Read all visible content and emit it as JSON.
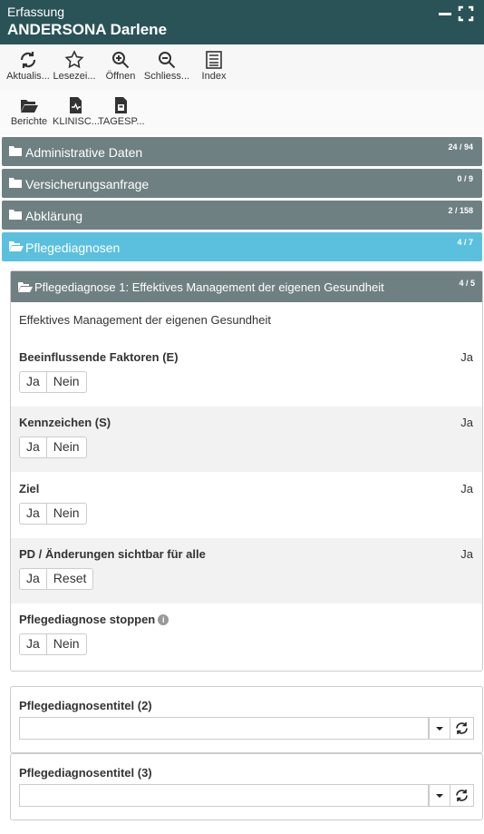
{
  "header": {
    "subtitle": "Erfassung",
    "patient": "ANDERSONA Darlene"
  },
  "toolbar1": [
    {
      "label": "Aktualis...",
      "icon": "refresh-icon"
    },
    {
      "label": "Lesezei...",
      "icon": "star-icon"
    },
    {
      "label": "Öffnen",
      "icon": "zoom-in-icon"
    },
    {
      "label": "Schliess...",
      "icon": "zoom-out-icon"
    },
    {
      "label": "Index",
      "icon": "index-list-icon"
    }
  ],
  "toolbar2": [
    {
      "label": "Berichte",
      "icon": "folder-open-icon"
    },
    {
      "label": "KLINISC...",
      "icon": "clinical-document-icon"
    },
    {
      "label": "TAGESP...",
      "icon": "daily-document-icon"
    }
  ],
  "sections": [
    {
      "title": "Administrative Daten",
      "count": "24 / 94"
    },
    {
      "title": "Versicherungsanfrage",
      "count": "0 / 9"
    },
    {
      "title": "Abklärung",
      "count": "2 / 158"
    },
    {
      "title": "Pflegediagnosen",
      "count": "4 / 7"
    }
  ],
  "diagnosis": {
    "title": "Pflegediagnose 1: Effektives Management der eigenen Gesundheit",
    "count": "4 / 5",
    "description": "Effektives Management der eigenen Gesundheit",
    "rows": [
      {
        "label": "Beeinflussende Faktoren (E)",
        "value": "Ja",
        "buttons": [
          "Ja",
          "Nein"
        ]
      },
      {
        "label": "Kennzeichen (S)",
        "value": "Ja",
        "buttons": [
          "Ja",
          "Nein"
        ]
      },
      {
        "label": "Ziel",
        "value": "Ja",
        "buttons": [
          "Ja",
          "Nein"
        ]
      },
      {
        "label": "PD / Änderungen sichtbar für alle",
        "value": "Ja",
        "buttons": [
          "Ja",
          "Reset"
        ]
      },
      {
        "label": "Pflegediagnose stoppen",
        "value": "",
        "buttons": [
          "Ja",
          "Nein"
        ],
        "info_icon": "info-icon"
      }
    ]
  },
  "title_fields": [
    {
      "label": "Pflegediagnosentitel (2)",
      "value": ""
    },
    {
      "label": "Pflegediagnosentitel (3)",
      "value": ""
    }
  ],
  "colors": {
    "header": "#2a5358",
    "section": "#6f8082",
    "section_active": "#5bc0de"
  }
}
